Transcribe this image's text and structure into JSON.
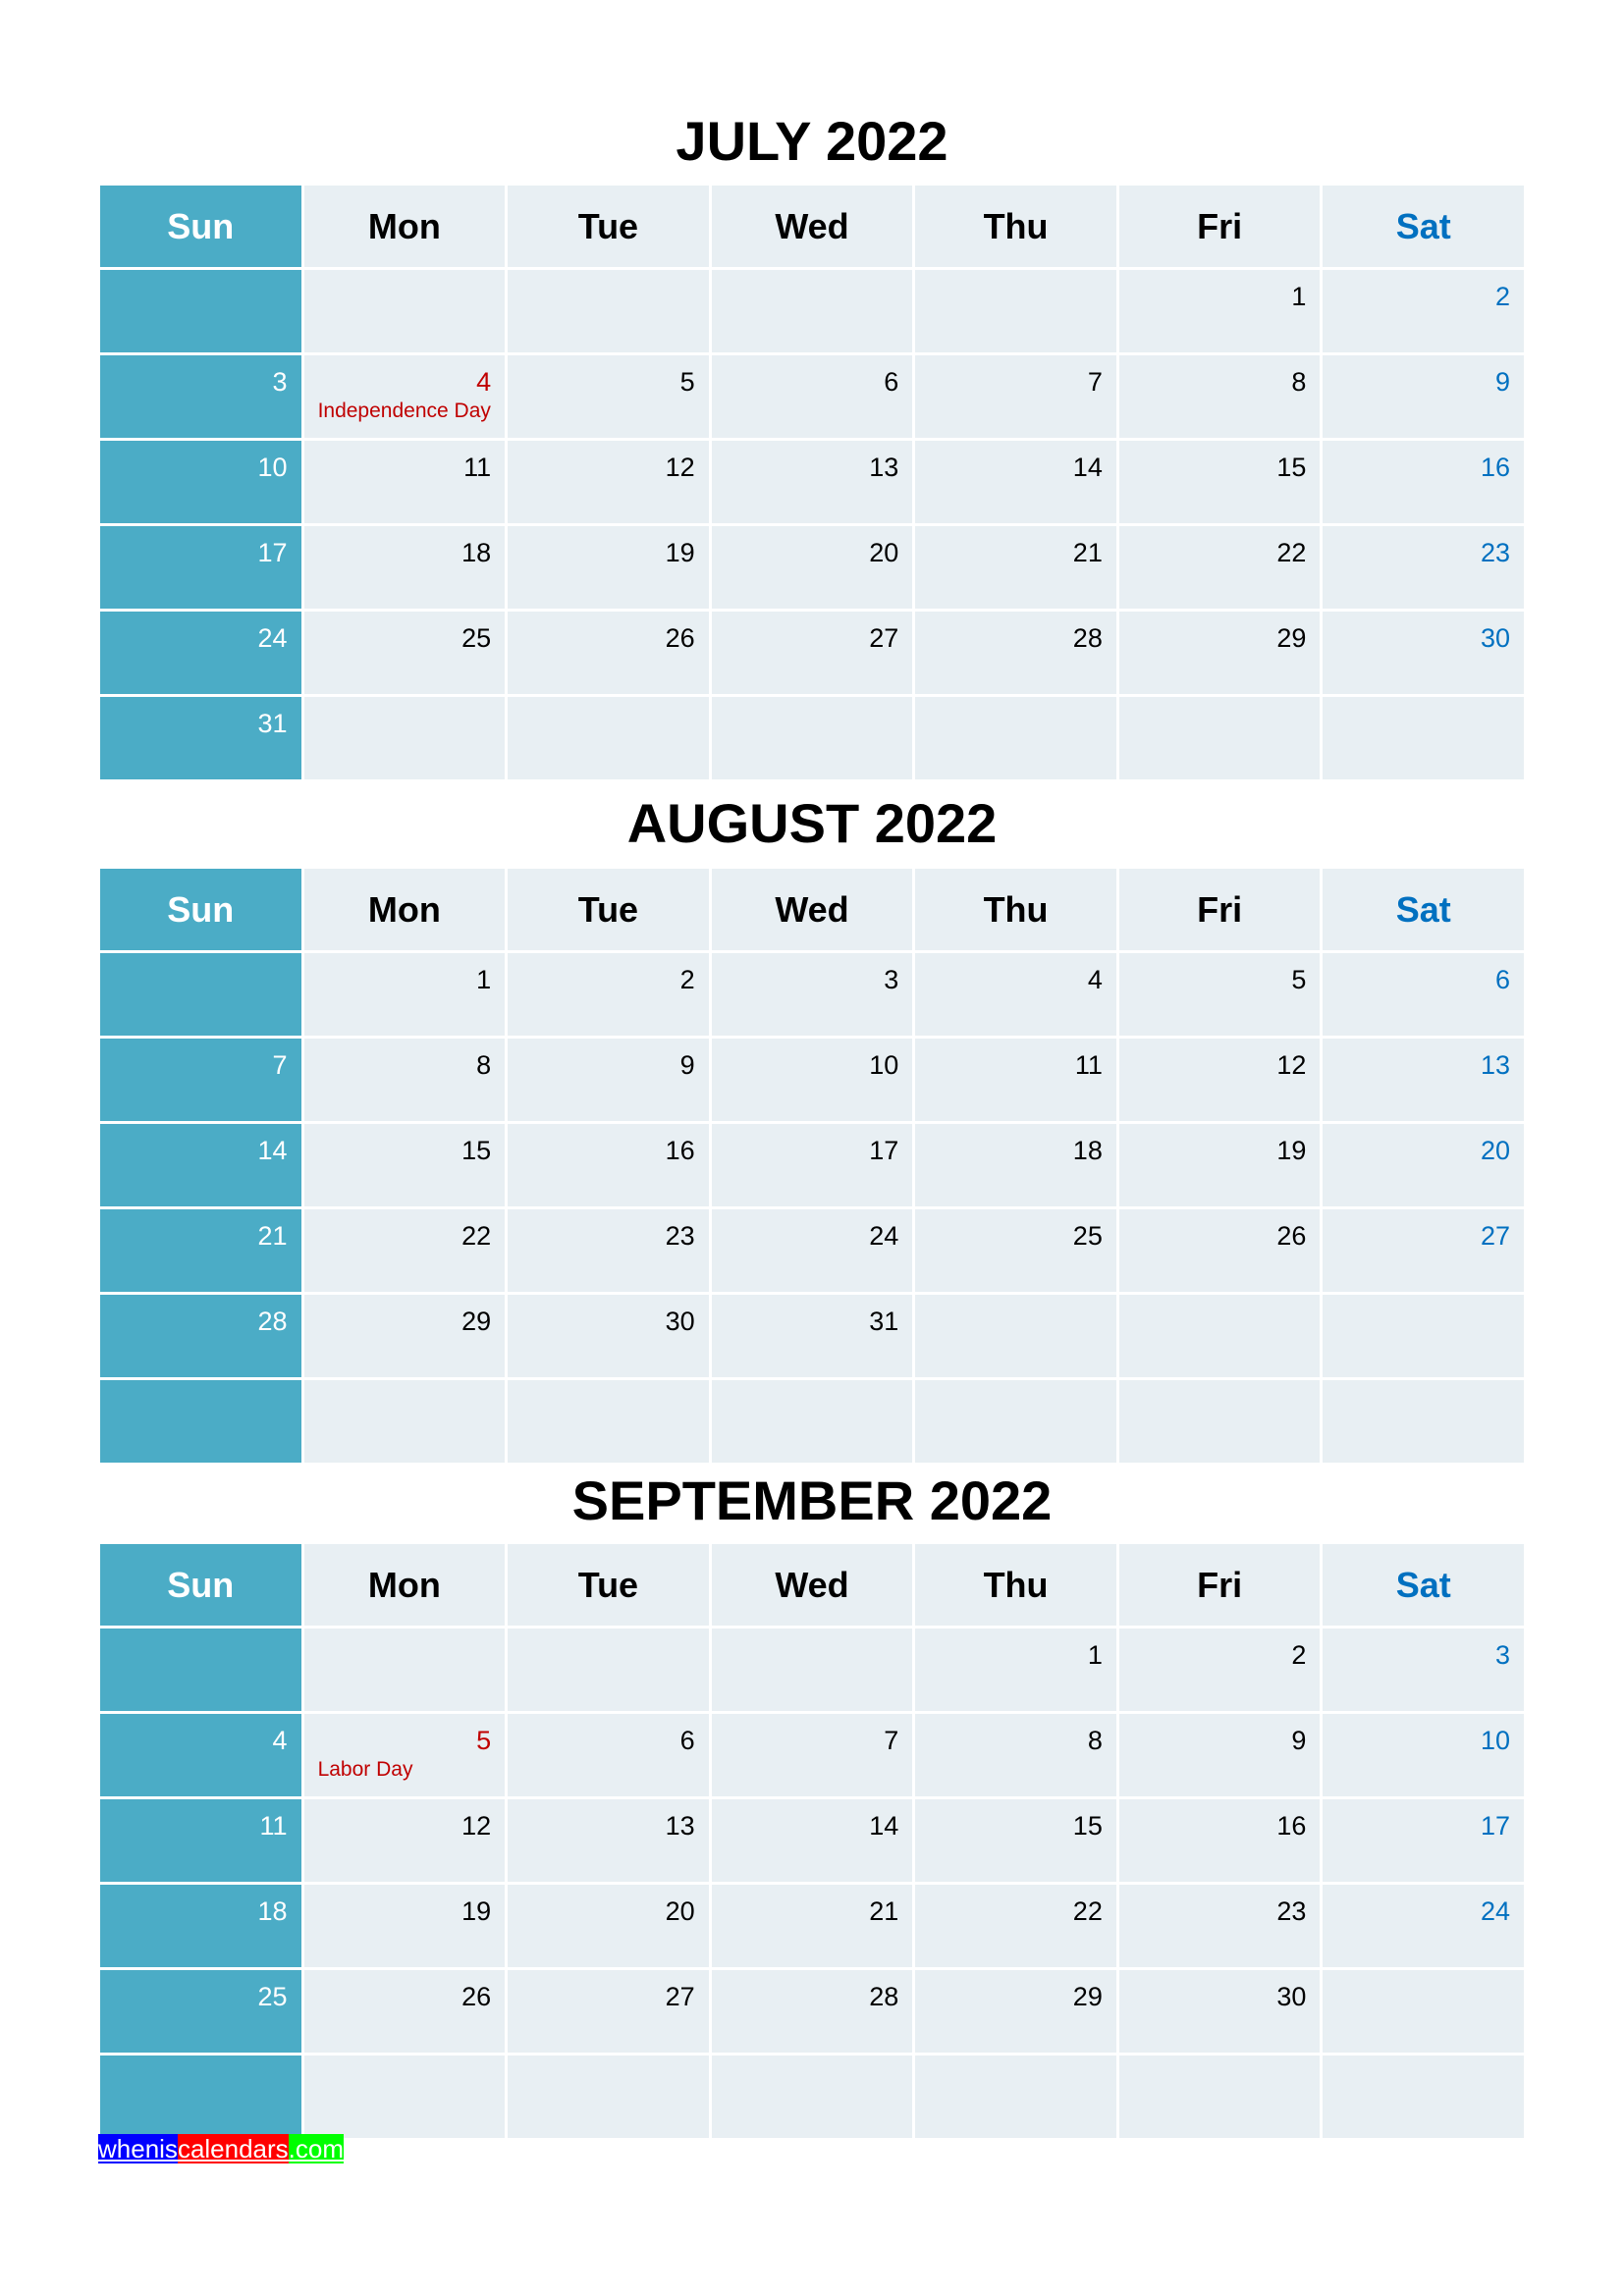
{
  "weekdays": [
    "Sun",
    "Mon",
    "Tue",
    "Wed",
    "Thu",
    "Fri",
    "Sat"
  ],
  "colors": {
    "sunday_fill": "#4BACC6",
    "cell_fill": "#E8EFF3",
    "saturday_text": "#0070C0",
    "holiday_text": "#C00000"
  },
  "months": [
    {
      "title": "JULY 2022",
      "weeks": [
        [
          "",
          "",
          "",
          "",
          "",
          "1",
          "2"
        ],
        [
          "3",
          "4",
          "5",
          "6",
          "7",
          "8",
          "9"
        ],
        [
          "10",
          "11",
          "12",
          "13",
          "14",
          "15",
          "16"
        ],
        [
          "17",
          "18",
          "19",
          "20",
          "21",
          "22",
          "23"
        ],
        [
          "24",
          "25",
          "26",
          "27",
          "28",
          "29",
          "30"
        ],
        [
          "31",
          "",
          "",
          "",
          "",
          "",
          ""
        ]
      ],
      "holidays": [
        {
          "day": "4",
          "name": "Independence Day"
        }
      ]
    },
    {
      "title": "AUGUST 2022",
      "weeks": [
        [
          "",
          "1",
          "2",
          "3",
          "4",
          "5",
          "6"
        ],
        [
          "7",
          "8",
          "9",
          "10",
          "11",
          "12",
          "13"
        ],
        [
          "14",
          "15",
          "16",
          "17",
          "18",
          "19",
          "20"
        ],
        [
          "21",
          "22",
          "23",
          "24",
          "25",
          "26",
          "27"
        ],
        [
          "28",
          "29",
          "30",
          "31",
          "",
          "",
          ""
        ],
        [
          "",
          "",
          "",
          "",
          "",
          "",
          ""
        ]
      ],
      "holidays": []
    },
    {
      "title": "SEPTEMBER 2022",
      "weeks": [
        [
          "",
          "",
          "",
          "",
          "1",
          "2",
          "3"
        ],
        [
          "4",
          "5",
          "6",
          "7",
          "8",
          "9",
          "10"
        ],
        [
          "11",
          "12",
          "13",
          "14",
          "15",
          "16",
          "17"
        ],
        [
          "18",
          "19",
          "20",
          "21",
          "22",
          "23",
          "24"
        ],
        [
          "25",
          "26",
          "27",
          "28",
          "29",
          "30",
          ""
        ],
        [
          "",
          "",
          "",
          "",
          "",
          "",
          ""
        ]
      ],
      "holidays": [
        {
          "day": "5",
          "name": "Labor Day"
        }
      ]
    }
  ],
  "footer": {
    "part1": "whenis",
    "part2": "calendars",
    "part3": ".com"
  }
}
